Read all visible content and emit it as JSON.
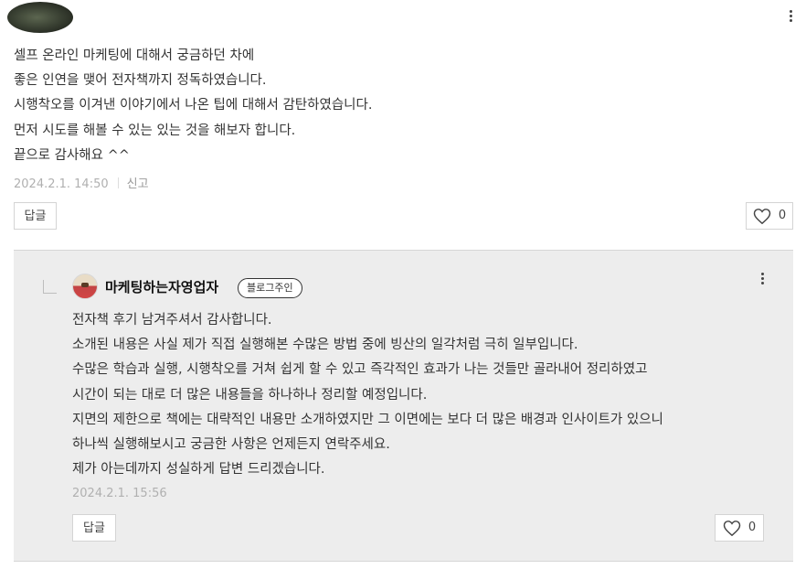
{
  "comment": {
    "lines": [
      "셀프 온라인 마케팅에 대해서 궁금하던 차에",
      "좋은 인연을 맺어 전자책까지 정독하였습니다.",
      "시행착오를 이겨낸 이야기에서 나온 팁에 대해서 감탄하였습니다.",
      "먼저 시도를 해볼 수 있는 있는 것을 해보자 합니다.",
      "끝으로 감사해요 ^^"
    ],
    "date": "2024.2.1. 14:50",
    "report_label": "신고",
    "reply_label": "답글",
    "like_count": "0"
  },
  "reply": {
    "author": "마케팅하는자영업자",
    "badge": "블로그주인",
    "lines": [
      "전자책 후기 남겨주셔서 감사합니다.",
      "소개된 내용은 사실 제가 직접 실행해본 수많은 방법 중에 빙산의 일각처럼 극히 일부입니다.",
      "수많은 학습과 실행, 시행착오를 거쳐 쉽게 할 수 있고 즉각적인 효과가 나는 것들만 골라내어 정리하였고",
      "시간이 되는 대로 더 많은 내용들을 하나하나 정리할 예정입니다.",
      "지면의 제한으로 책에는 대략적인 내용만 소개하였지만 그 이면에는 보다 더 많은 배경과 인사이트가 있으니",
      "하나씩 실행해보시고 궁금한 사항은 언제든지 연락주세요.",
      "제가 아는데까지 성실하게 답변 드리겠습니다."
    ],
    "date": "2024.2.1. 15:56",
    "reply_label": "답글",
    "like_count": "0"
  },
  "icons": [
    "more-options-icon",
    "heart-icon",
    "reply-indent-icon"
  ]
}
